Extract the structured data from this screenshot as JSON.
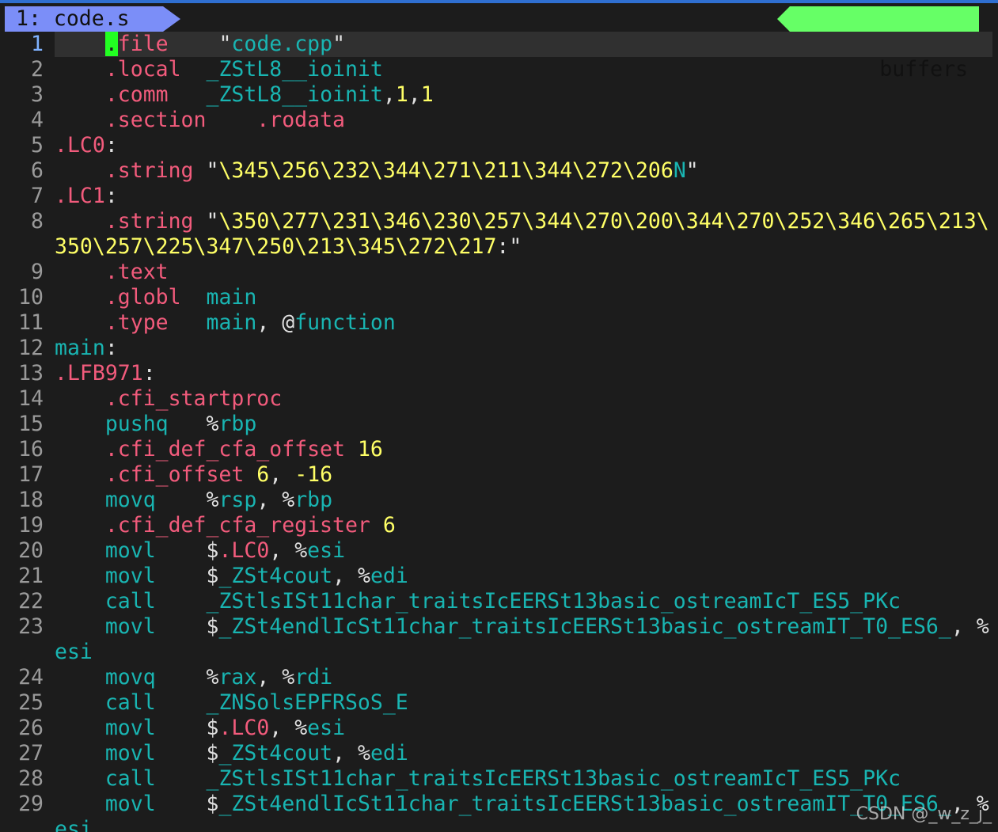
{
  "tab": {
    "label": "1: code.s"
  },
  "buffers_label": "buffers",
  "current_line": 1,
  "watermark": "CSDN @_w_z_j_",
  "colors": {
    "directive": "#f25b7c",
    "instruction": "#19b5b2",
    "string": "#ffff66",
    "number": "#ffff66",
    "cursor": "#22ff22",
    "tab_bg": "#7b8ef8",
    "buffers_bg": "#66ff66"
  },
  "lines": [
    {
      "n": "1",
      "tokens": [
        [
          "    ",
          "pun"
        ],
        [
          ".",
          "cursor"
        ],
        [
          "file",
          "cursor-tail"
        ],
        [
          "    ",
          "pun"
        ],
        [
          "\"",
          "strq"
        ],
        [
          "code.cpp",
          "sym"
        ],
        [
          "\"",
          "strq"
        ]
      ]
    },
    {
      "n": "2",
      "tokens": [
        [
          "    ",
          "pun"
        ],
        [
          ".local",
          "dir"
        ],
        [
          "  ",
          "pun"
        ],
        [
          "_ZStL8__ioinit",
          "sym"
        ]
      ]
    },
    {
      "n": "3",
      "tokens": [
        [
          "    ",
          "pun"
        ],
        [
          ".comm",
          "dir"
        ],
        [
          "   ",
          "pun"
        ],
        [
          "_ZStL8__ioinit",
          "sym"
        ],
        [
          ",",
          "pun"
        ],
        [
          "1",
          "num"
        ],
        [
          ",",
          "pun"
        ],
        [
          "1",
          "num"
        ]
      ]
    },
    {
      "n": "4",
      "tokens": [
        [
          "    ",
          "pun"
        ],
        [
          ".section",
          "dir"
        ],
        [
          "    ",
          "pun"
        ],
        [
          ".rodata",
          "dir"
        ]
      ]
    },
    {
      "n": "5",
      "tokens": [
        [
          ".LC0",
          "lbl"
        ],
        [
          ":",
          "pun"
        ]
      ]
    },
    {
      "n": "6",
      "tokens": [
        [
          "    ",
          "pun"
        ],
        [
          ".string",
          "dir"
        ],
        [
          " ",
          "pun"
        ],
        [
          "\"",
          "strq"
        ],
        [
          "\\345\\256\\232\\344\\271\\211\\344\\272\\206",
          "str"
        ],
        [
          "N",
          "sym"
        ],
        [
          "\"",
          "strq"
        ]
      ]
    },
    {
      "n": "7",
      "tokens": [
        [
          ".LC1",
          "lbl"
        ],
        [
          ":",
          "pun"
        ]
      ]
    },
    {
      "n": "8",
      "tokens": [
        [
          "    ",
          "pun"
        ],
        [
          ".string",
          "dir"
        ],
        [
          " ",
          "pun"
        ],
        [
          "\"",
          "strq"
        ],
        [
          "\\350\\277\\231\\346\\230\\257\\344\\270\\200\\344\\270\\252\\346\\265\\213\\",
          "str"
        ]
      ]
    },
    {
      "n": "",
      "tokens": [
        [
          "350\\257\\225\\347\\250\\213\\345\\272\\217",
          "str"
        ],
        [
          ":",
          "pun"
        ],
        [
          "\"",
          "strq"
        ]
      ]
    },
    {
      "n": "9",
      "tokens": [
        [
          "    ",
          "pun"
        ],
        [
          ".text",
          "dir"
        ]
      ]
    },
    {
      "n": "10",
      "tokens": [
        [
          "    ",
          "pun"
        ],
        [
          ".globl",
          "dir"
        ],
        [
          "  ",
          "pun"
        ],
        [
          "main",
          "sym"
        ]
      ]
    },
    {
      "n": "11",
      "tokens": [
        [
          "    ",
          "pun"
        ],
        [
          ".type",
          "dir"
        ],
        [
          "   ",
          "pun"
        ],
        [
          "main",
          "sym"
        ],
        [
          ", ",
          "pun"
        ],
        [
          "@",
          "pun"
        ],
        [
          "function",
          "sym"
        ]
      ]
    },
    {
      "n": "12",
      "tokens": [
        [
          "main",
          "sym"
        ],
        [
          ":",
          "pun"
        ]
      ]
    },
    {
      "n": "13",
      "tokens": [
        [
          ".LFB971",
          "lbl"
        ],
        [
          ":",
          "pun"
        ]
      ]
    },
    {
      "n": "14",
      "tokens": [
        [
          "    ",
          "pun"
        ],
        [
          ".cfi_startproc",
          "dir"
        ]
      ]
    },
    {
      "n": "15",
      "tokens": [
        [
          "    ",
          "pun"
        ],
        [
          "pushq",
          "ins"
        ],
        [
          "   ",
          "pun"
        ],
        [
          "%",
          "pct"
        ],
        [
          "rbp",
          "reg"
        ]
      ]
    },
    {
      "n": "16",
      "tokens": [
        [
          "    ",
          "pun"
        ],
        [
          ".cfi_def_cfa_offset",
          "dir"
        ],
        [
          " ",
          "pun"
        ],
        [
          "16",
          "num"
        ]
      ]
    },
    {
      "n": "17",
      "tokens": [
        [
          "    ",
          "pun"
        ],
        [
          ".cfi_offset",
          "dir"
        ],
        [
          " ",
          "pun"
        ],
        [
          "6",
          "num"
        ],
        [
          ", ",
          "pun"
        ],
        [
          "-16",
          "num"
        ]
      ]
    },
    {
      "n": "18",
      "tokens": [
        [
          "    ",
          "pun"
        ],
        [
          "movq",
          "ins"
        ],
        [
          "    ",
          "pun"
        ],
        [
          "%",
          "pct"
        ],
        [
          "rsp",
          "reg"
        ],
        [
          ", ",
          "pun"
        ],
        [
          "%",
          "pct"
        ],
        [
          "rbp",
          "reg"
        ]
      ]
    },
    {
      "n": "19",
      "tokens": [
        [
          "    ",
          "pun"
        ],
        [
          ".cfi_def_cfa_register",
          "dir"
        ],
        [
          " ",
          "pun"
        ],
        [
          "6",
          "num"
        ]
      ]
    },
    {
      "n": "20",
      "tokens": [
        [
          "    ",
          "pun"
        ],
        [
          "movl",
          "ins"
        ],
        [
          "    ",
          "pun"
        ],
        [
          "$",
          "pun"
        ],
        [
          ".LC0",
          "lbl"
        ],
        [
          ", ",
          "pun"
        ],
        [
          "%",
          "pct"
        ],
        [
          "esi",
          "reg"
        ]
      ]
    },
    {
      "n": "21",
      "tokens": [
        [
          "    ",
          "pun"
        ],
        [
          "movl",
          "ins"
        ],
        [
          "    ",
          "pun"
        ],
        [
          "$",
          "pun"
        ],
        [
          "_ZSt4cout",
          "sym"
        ],
        [
          ", ",
          "pun"
        ],
        [
          "%",
          "pct"
        ],
        [
          "edi",
          "reg"
        ]
      ]
    },
    {
      "n": "22",
      "tokens": [
        [
          "    ",
          "pun"
        ],
        [
          "call",
          "ins"
        ],
        [
          "    ",
          "pun"
        ],
        [
          "_ZStlsISt11char_traitsIcEERSt13basic_ostreamIcT_ES5_PKc",
          "sym"
        ]
      ]
    },
    {
      "n": "23",
      "tokens": [
        [
          "    ",
          "pun"
        ],
        [
          "movl",
          "ins"
        ],
        [
          "    ",
          "pun"
        ],
        [
          "$",
          "pun"
        ],
        [
          "_ZSt4endlIcSt11char_traitsIcEERSt13basic_ostreamIT_T0_ES6_",
          "sym"
        ],
        [
          ", ",
          "pun"
        ],
        [
          "%",
          "pct"
        ]
      ]
    },
    {
      "n": "",
      "tokens": [
        [
          "esi",
          "reg"
        ]
      ]
    },
    {
      "n": "24",
      "tokens": [
        [
          "    ",
          "pun"
        ],
        [
          "movq",
          "ins"
        ],
        [
          "    ",
          "pun"
        ],
        [
          "%",
          "pct"
        ],
        [
          "rax",
          "reg"
        ],
        [
          ", ",
          "pun"
        ],
        [
          "%",
          "pct"
        ],
        [
          "rdi",
          "reg"
        ]
      ]
    },
    {
      "n": "25",
      "tokens": [
        [
          "    ",
          "pun"
        ],
        [
          "call",
          "ins"
        ],
        [
          "    ",
          "pun"
        ],
        [
          "_ZNSolsEPFRSoS_E",
          "sym"
        ]
      ]
    },
    {
      "n": "26",
      "tokens": [
        [
          "    ",
          "pun"
        ],
        [
          "movl",
          "ins"
        ],
        [
          "    ",
          "pun"
        ],
        [
          "$",
          "pun"
        ],
        [
          ".LC0",
          "lbl"
        ],
        [
          ", ",
          "pun"
        ],
        [
          "%",
          "pct"
        ],
        [
          "esi",
          "reg"
        ]
      ]
    },
    {
      "n": "27",
      "tokens": [
        [
          "    ",
          "pun"
        ],
        [
          "movl",
          "ins"
        ],
        [
          "    ",
          "pun"
        ],
        [
          "$",
          "pun"
        ],
        [
          "_ZSt4cout",
          "sym"
        ],
        [
          ", ",
          "pun"
        ],
        [
          "%",
          "pct"
        ],
        [
          "edi",
          "reg"
        ]
      ]
    },
    {
      "n": "28",
      "tokens": [
        [
          "    ",
          "pun"
        ],
        [
          "call",
          "ins"
        ],
        [
          "    ",
          "pun"
        ],
        [
          "_ZStlsISt11char_traitsIcEERSt13basic_ostreamIcT_ES5_PKc",
          "sym"
        ]
      ]
    },
    {
      "n": "29",
      "tokens": [
        [
          "    ",
          "pun"
        ],
        [
          "movl",
          "ins"
        ],
        [
          "    ",
          "pun"
        ],
        [
          "$",
          "pun"
        ],
        [
          "_ZSt4endlIcSt11char_traitsIcEERSt13basic_ostreamIT_T0_ES6_",
          "sym"
        ],
        [
          ", ",
          "pun"
        ],
        [
          "%",
          "pct"
        ]
      ]
    },
    {
      "n": "",
      "tokens": [
        [
          "esi",
          "reg"
        ]
      ]
    }
  ]
}
